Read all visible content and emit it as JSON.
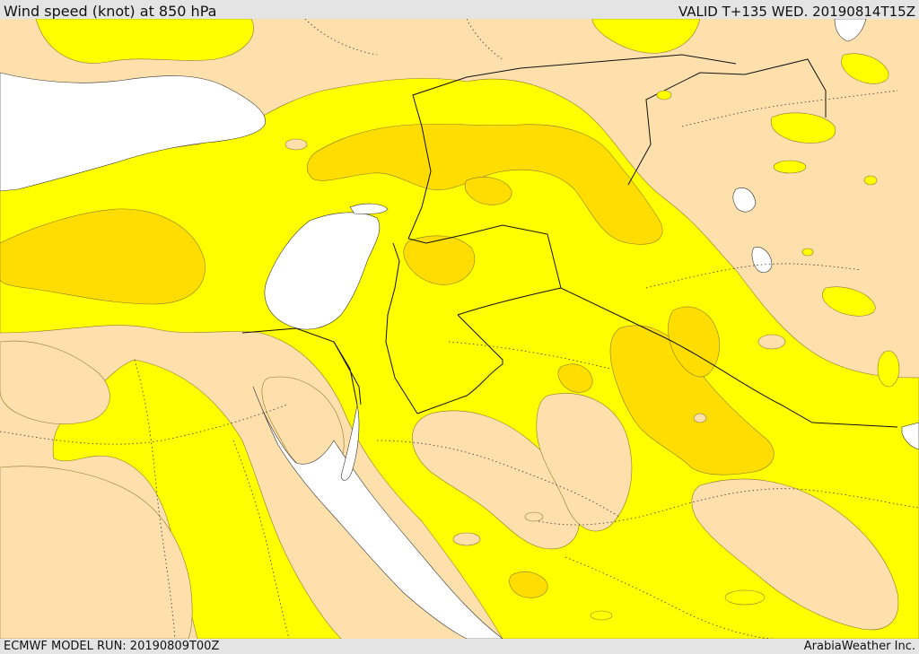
{
  "header": {
    "title": "Wind speed (knot) at 850 hPa",
    "valid": "VALID T+135 WED. 20190814T15Z"
  },
  "footer": {
    "model_run": "ECMWF MODEL RUN: 20190809T00Z",
    "credit": "ArabiaWeather Inc."
  },
  "colors": {
    "land_light": "#fde0ac",
    "wind_yellow": "#ffff00",
    "wind_gold": "#ffdd00",
    "water": "#ffffff",
    "border": "#111111"
  }
}
